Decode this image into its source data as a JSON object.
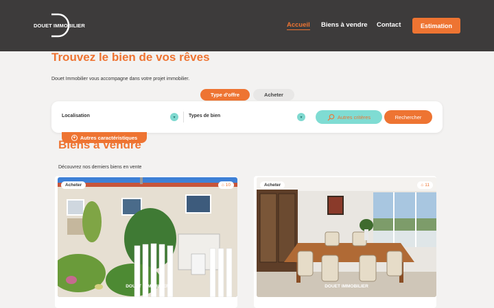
{
  "header": {
    "logo_text": "DOUET IMMOBILIER",
    "nav": [
      "Accueil",
      "Biens à vendre",
      "Contact"
    ],
    "cta": "Estimation"
  },
  "hero": {
    "title": "Trouvez le bien de vos rêves",
    "subtitle": "Douet Immobilier vous accompagne dans votre projet immobilier.",
    "tabs": [
      "Type d'offre",
      "Acheter"
    ]
  },
  "search": {
    "location_label": "Localisation",
    "type_label": "Types de bien",
    "criteria_label": "Autres critères",
    "submit_label": "Rechercher",
    "more_label": "Autres caractéristiques"
  },
  "listings": {
    "title": "Biens à vendre",
    "subtitle": "Découvrez nos derniers biens en vente",
    "cards": [
      {
        "badge": "Acheter",
        "photos": "10",
        "watermark": "DOUET IMMOBILIER"
      },
      {
        "badge": "Acheter",
        "photos": "11",
        "watermark": "DOUET IMMOBILIER"
      }
    ]
  },
  "colors": {
    "accent": "#ee7432",
    "teal": "#7fdcd3",
    "header": "#3d3b3b"
  }
}
